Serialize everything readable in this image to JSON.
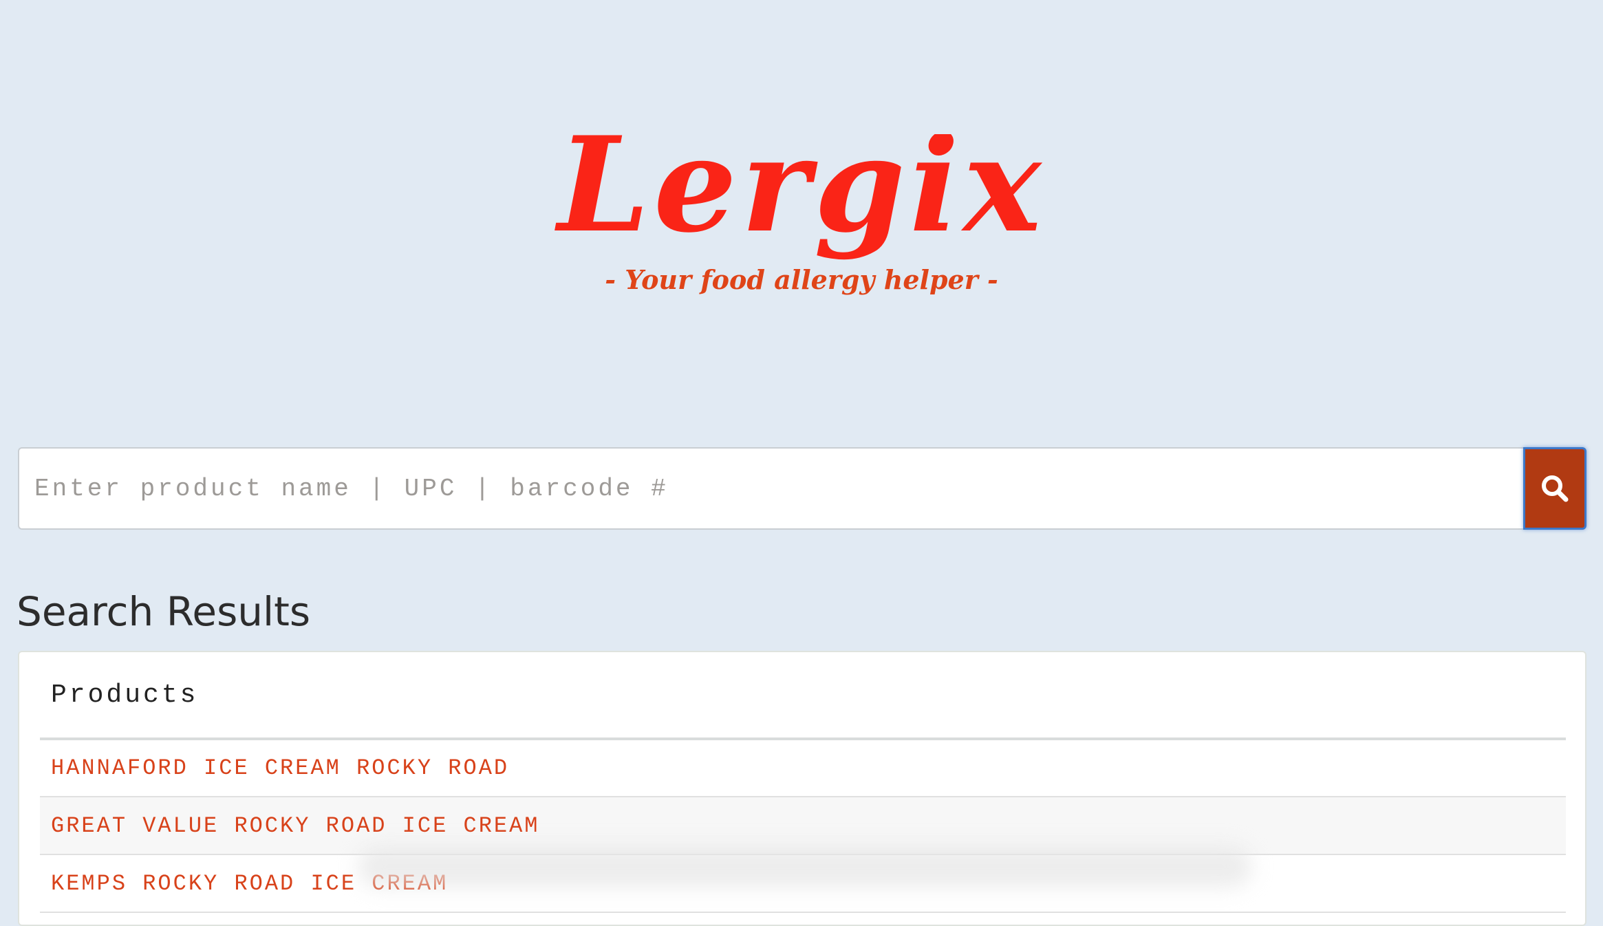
{
  "brand": {
    "name": "Lergix",
    "tagline": "- Your food allergy helper -",
    "color": "#fa2417",
    "tagline_color": "#df4418"
  },
  "search": {
    "placeholder": "Enter product name | UPC | barcode #",
    "value": "",
    "button_icon": "search-icon",
    "button_color": "#b13a12"
  },
  "results": {
    "title": "Search Results",
    "column_header": "Products",
    "rows": [
      "HANNAFORD ICE CREAM ROCKY ROAD",
      "GREAT VALUE ROCKY ROAD ICE CREAM",
      "KEMPS ROCKY ROAD ICE CREAM"
    ],
    "link_color": "#d8421a"
  }
}
